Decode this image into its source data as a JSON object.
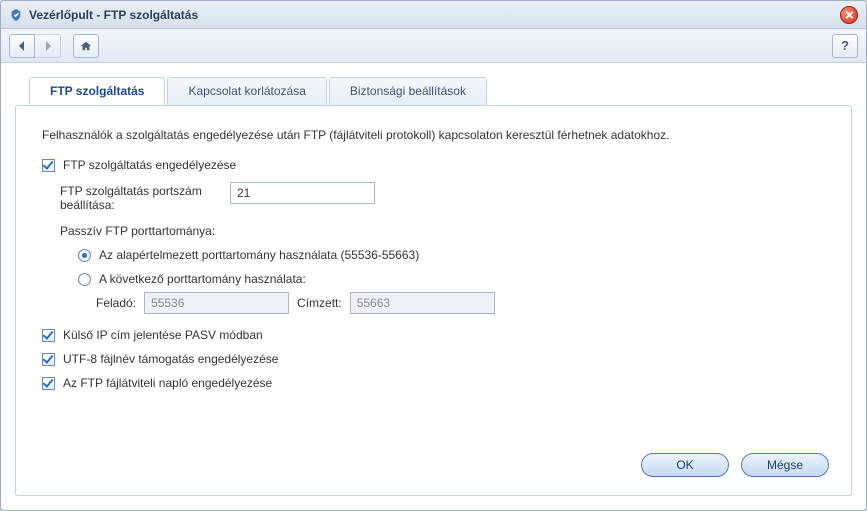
{
  "window": {
    "title": "Vezérlőpult - FTP szolgáltatás"
  },
  "toolbar": {
    "back": "Vissza",
    "forward": "Előre",
    "home": "Kezdőlap",
    "help": "?"
  },
  "tabs": [
    {
      "label": "FTP szolgáltatás",
      "active": true
    },
    {
      "label": "Kapcsolat korlátozása",
      "active": false
    },
    {
      "label": "Biztonsági beállítások",
      "active": false
    }
  ],
  "ftp": {
    "description": "Felhasználók a szolgáltatás engedélyezése után FTP (fájlátviteli protokoll) kapcsolaton keresztül férhetnek adatokhoz.",
    "enable_label": "FTP szolgáltatás engedélyezése",
    "enable_checked": true,
    "port_label": "FTP szolgáltatás portszám beállítása:",
    "port_value": "21",
    "passive_label": "Passzív FTP porttartománya:",
    "radio_default_label": "Az alapértelmezett porttartomány használata (55536-55663)",
    "radio_custom_label": "A következő porttartomány használata:",
    "radio_selected": "default",
    "from_label": "Feladó:",
    "from_value": "55536",
    "to_label": "Címzett:",
    "to_value": "55663",
    "ext_ip_label": "Külső IP cím jelentése PASV módban",
    "ext_ip_checked": true,
    "utf8_label": "UTF-8 fájlnév támogatás engedélyezése",
    "utf8_checked": true,
    "log_label": "Az FTP fájlátviteli napló engedélyezése",
    "log_checked": true
  },
  "buttons": {
    "ok": "OK",
    "cancel": "Mégse"
  }
}
